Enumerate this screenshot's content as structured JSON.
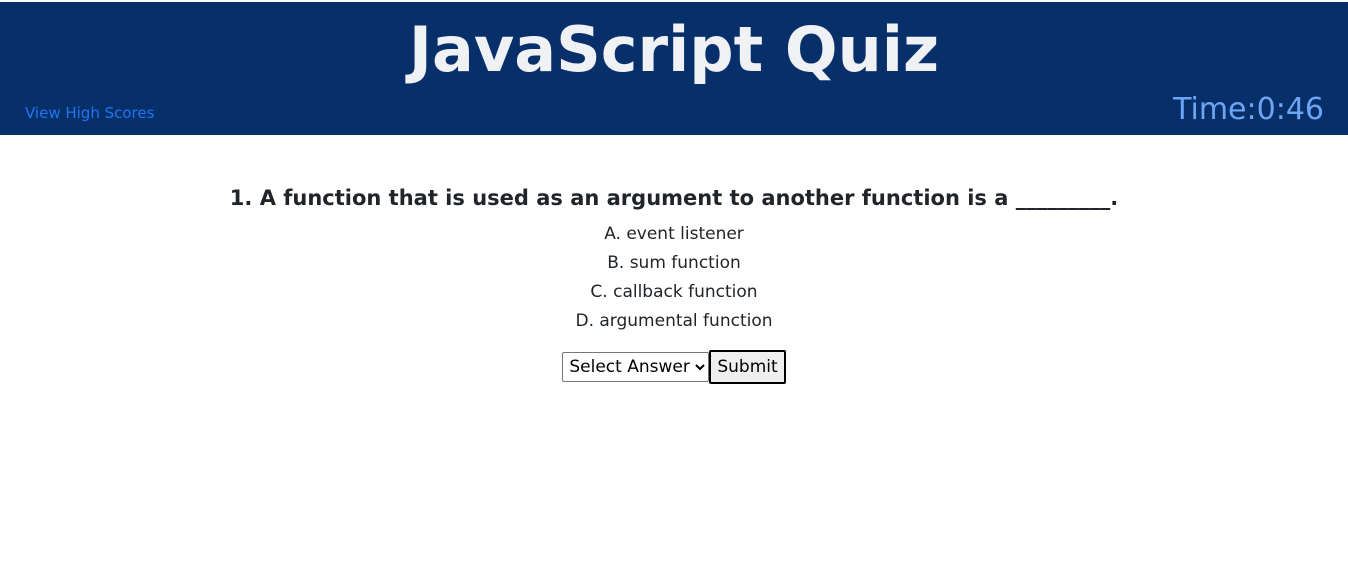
{
  "header": {
    "title": "JavaScript Quiz",
    "high_scores_link": "View High Scores",
    "timer": "Time:0:46",
    "background_color": "#072f6a",
    "title_color": "#f0f1f5",
    "link_color": "#1f76f2",
    "timer_color": "#6ea4f4"
  },
  "question": {
    "text": "1. A function that is used as an argument to another function is a _________.",
    "choices": [
      "A. event listener",
      "B. sum function",
      "C. callback function",
      "D. argumental function"
    ]
  },
  "answer": {
    "select_label": "Select Answer",
    "options": [
      "Select Answer"
    ],
    "submit_label": "Submit"
  }
}
